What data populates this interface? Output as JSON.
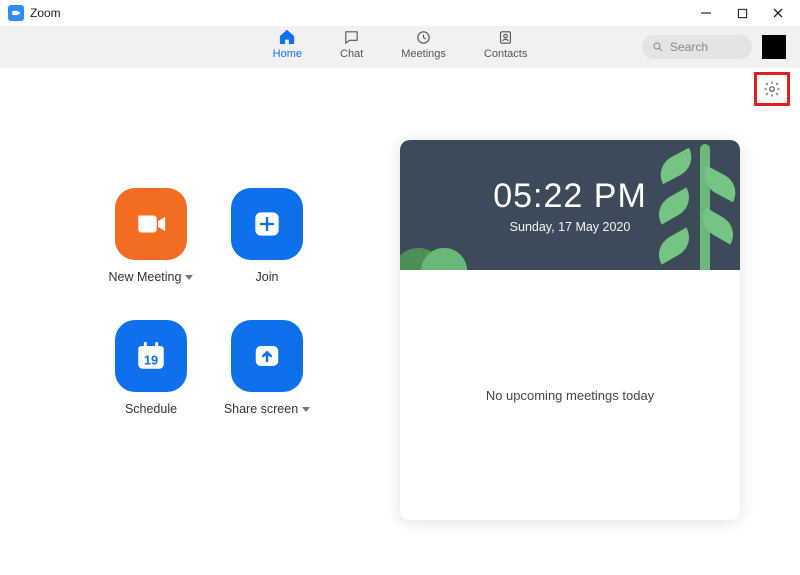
{
  "window": {
    "title": "Zoom"
  },
  "nav": {
    "items": [
      {
        "label": "Home"
      },
      {
        "label": "Chat"
      },
      {
        "label": "Meetings"
      },
      {
        "label": "Contacts"
      }
    ],
    "search_placeholder": "Search"
  },
  "actions": {
    "new_meeting": "New Meeting",
    "join": "Join",
    "schedule": "Schedule",
    "schedule_day": "19",
    "share_screen": "Share screen"
  },
  "panel": {
    "time": "05:22 PM",
    "date": "Sunday, 17 May 2020",
    "empty_message": "No upcoming meetings today"
  }
}
